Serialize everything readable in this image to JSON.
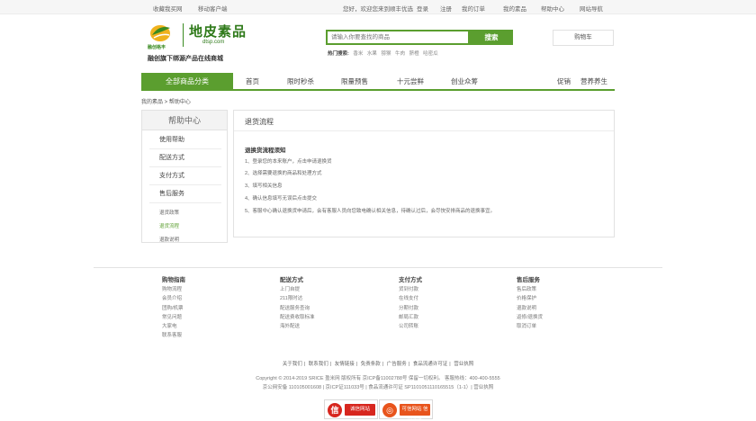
{
  "topbar": {
    "favorite": "收藏我买网",
    "mobile": "移动客户端",
    "welcome": "您好，欢迎您来到顺丰优选",
    "login": "登录",
    "register": "注册",
    "my_orders": "我的订单",
    "my_suo": "我的素品",
    "help_center": "帮助中心",
    "site_nav": "网站导航"
  },
  "logo": {
    "brand_small": "融创格丰",
    "title": "地皮素品",
    "url": "dtsp.com",
    "slogan": "融创旗下绑源产品在线商城"
  },
  "search": {
    "placeholder": "请输入你要查找的商品",
    "button": "搜索",
    "hot_label": "热门搜索:",
    "hot_terms": [
      "香米",
      "水果",
      "猕猴",
      "牛肉",
      "脐橙",
      "哈密瓜"
    ]
  },
  "cart": {
    "label": "购物车"
  },
  "nav": {
    "all_categories": "全部商品分类",
    "items": [
      "首页",
      "限时秒杀",
      "限量预售",
      "十元尝鲜",
      "创业众筹"
    ],
    "right_items": [
      "促销",
      "营养养生"
    ]
  },
  "breadcrumb": "我的素品 > 帮助中心",
  "sidebar": {
    "title": "帮助中心",
    "sections": [
      "使用帮助",
      "配送方式",
      "支付方式",
      "售后服务"
    ],
    "subitems": [
      "退货政策",
      "退货流程",
      "退款说明"
    ],
    "active_sub": "退货流程"
  },
  "content": {
    "title": "退货流程",
    "subtitle": "退换货流程须知",
    "steps": [
      "1、登录您的本来账户，点击申请退换货",
      "2、选择需要退换的商品和处理方式",
      "3、填写相关信息",
      "4、确认信息填写无误后点击提交",
      "5、客服中心确认退换货申请后，会有客服人员向您致电确认相关信息，待确认过后，会尽快安排商品的退换事宜。"
    ]
  },
  "footer": {
    "columns": [
      {
        "title": "购物指南",
        "items": [
          "购物流程",
          "会员介绍",
          "团购/机票",
          "常见问题",
          "大家电",
          "联系客服"
        ]
      },
      {
        "title": "配送方式",
        "items": [
          "上门自提",
          "211限时达",
          "配送服务查询",
          "配送费收取标准",
          "海外配送"
        ]
      },
      {
        "title": "支付方式",
        "items": [
          "货到付款",
          "在线支付",
          "分期付款",
          "邮局汇款",
          "公司转账"
        ]
      },
      {
        "title": "售后服务",
        "items": [
          "售后政策",
          "价格保护",
          "退款说明",
          "返修/退换货",
          "取消订单"
        ]
      }
    ],
    "links": [
      "关于我们",
      "联系我们",
      "友情链接",
      "免责条款",
      "广告服务",
      "食品流通许可证",
      "营业执照"
    ],
    "copyright1": "Copyright © 2014-2019 SRICE 盈米网 版权所有 京ICP备11002788号 保留一切权利。 客服热线：400-400-5555",
    "copyright2": "京公网安备 110105001608 | 京ICP证111033号 | 食品流通许可证 SP1101051110165515（1-1）| 营业执照",
    "badge1": "诚信网站",
    "badge2": "可信网站 信用评价"
  },
  "colors": {
    "accent": "#5b9e2f",
    "badge_red": "#d7261e"
  }
}
